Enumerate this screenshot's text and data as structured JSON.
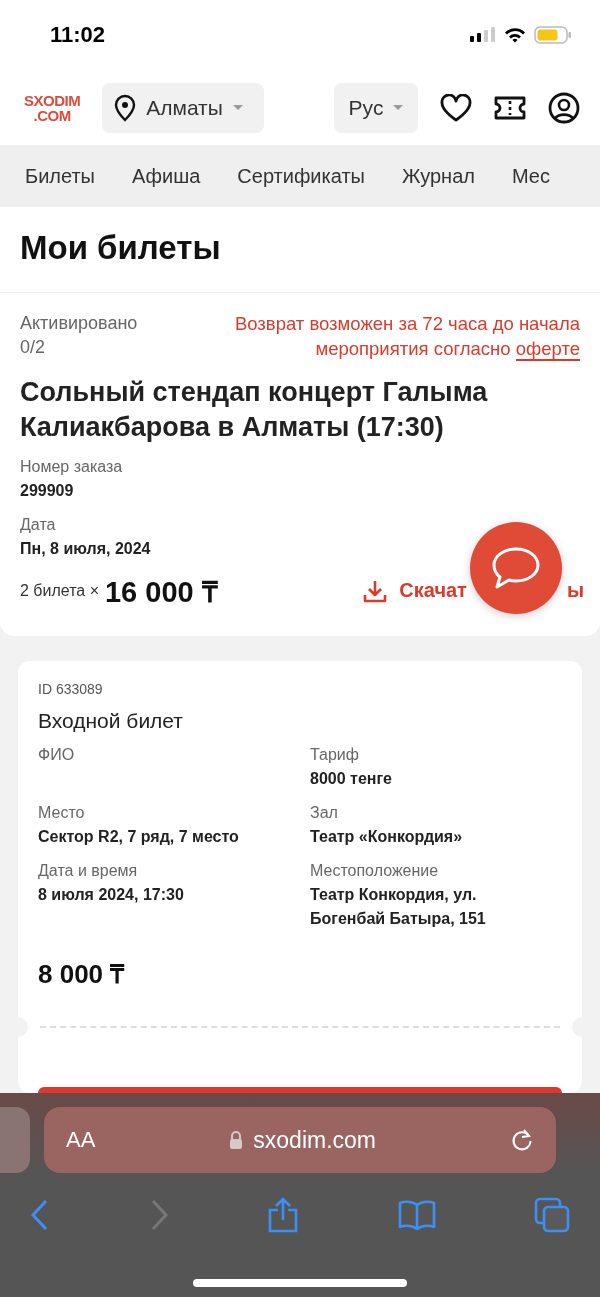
{
  "status_bar": {
    "time": "11:02"
  },
  "header": {
    "logo_top": "SXODIM",
    "logo_bottom": ".COM",
    "city": "Алматы",
    "language": "Рус"
  },
  "nav": [
    {
      "label": "Билеты"
    },
    {
      "label": "Афиша"
    },
    {
      "label": "Сертификаты"
    },
    {
      "label": "Журнал"
    },
    {
      "label": "Мес"
    }
  ],
  "page_title": "Мои билеты",
  "order": {
    "activated_label": "Активировано",
    "activated_count": "0/2",
    "refund_text": "Возврат возможен за 72 часа до начала мероприятия согласно",
    "refund_link": "оферте",
    "event_title": "Сольный стендап концерт Галыма Калиакбарова в Алматы (17:30)",
    "fields": [
      {
        "label": "Номер заказа",
        "value": "299909"
      },
      {
        "label": "Дата",
        "value": "Пн, 8 июля, 2024"
      }
    ],
    "quantity": "2 билета ×",
    "total": "16 000 ₸",
    "download_label_start": "Скачат",
    "download_label_end": "ы"
  },
  "ticket": {
    "id": "ID 633089",
    "type": "Входной билет",
    "fields": [
      {
        "label": "ФИО"
      },
      {
        "label": "Тариф",
        "value": "8000 тенге"
      },
      {
        "label": "Место",
        "value": "Сектор R2, 7 ряд, 7 место"
      },
      {
        "label": "Зал",
        "value": "Театр «Конкордия»"
      },
      {
        "label": "Дата и время",
        "value": "8 июля 2024, 17:30"
      },
      {
        "label": "Местоположение",
        "value": "Театр Конкордия, ул. Богенбай Батыра, 151"
      }
    ],
    "price": "8 000 ₸"
  },
  "browser": {
    "text_size": "AA",
    "url": "sxodim.com"
  }
}
